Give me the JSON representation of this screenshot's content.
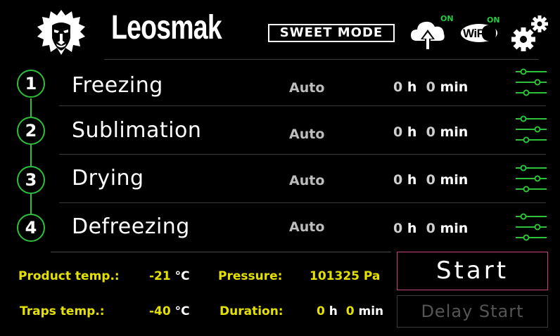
{
  "header": {
    "brand": "Leosmak",
    "mode_label": "SWEET MODE",
    "cloud_status": "ON",
    "wifi_label": "WiFi",
    "wifi_status": "ON"
  },
  "steps": [
    {
      "num": "1",
      "name": "Freezing",
      "mode": "Auto",
      "hours": "0",
      "hours_unit": "h",
      "minutes": "0",
      "minutes_unit": "min"
    },
    {
      "num": "2",
      "name": "Sublimation",
      "mode": "Auto",
      "hours": "0",
      "hours_unit": "h",
      "minutes": "0",
      "minutes_unit": "min"
    },
    {
      "num": "3",
      "name": "Drying",
      "mode": "Auto",
      "hours": "0",
      "hours_unit": "h",
      "minutes": "0",
      "minutes_unit": "min"
    },
    {
      "num": "4",
      "name": "Defreezing",
      "mode": "Auto",
      "hours": "0",
      "hours_unit": "h",
      "minutes": "0",
      "minutes_unit": "min"
    }
  ],
  "status": {
    "product_temp_label": "Product temp.:",
    "product_temp_value": "-21",
    "product_temp_unit": "°C",
    "traps_temp_label": "Traps temp.:",
    "traps_temp_value": "-40",
    "traps_temp_unit": "°C",
    "pressure_label": "Pressure:",
    "pressure_value": "101325",
    "pressure_unit": "Pa",
    "duration_label": "Duration:",
    "duration_hours": "0",
    "duration_hours_unit": "h",
    "duration_minutes": "0",
    "duration_minutes_unit": "min"
  },
  "buttons": {
    "start": "Start",
    "delay_start": "Delay Start"
  },
  "colors": {
    "accent_green": "#2fbf3a",
    "label_yellow": "#e4e000",
    "start_border": "#c2427a"
  }
}
